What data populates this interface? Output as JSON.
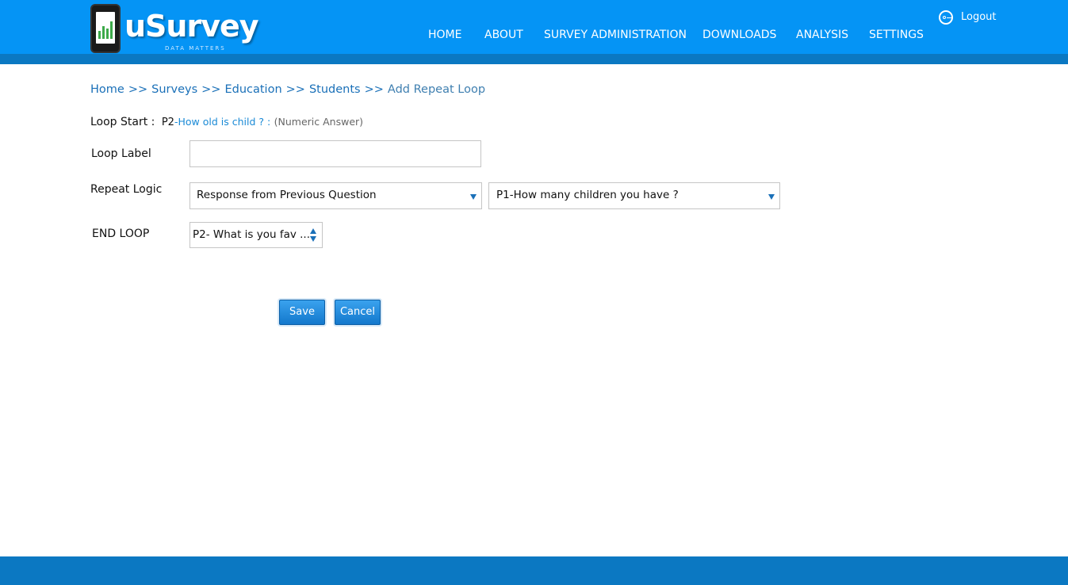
{
  "brand": {
    "name": "uSurvey",
    "tagline": "DATA MATTERS"
  },
  "nav": {
    "items": [
      {
        "label": "HOME"
      },
      {
        "label": "ABOUT"
      },
      {
        "label": "SURVEY ADMINISTRATION"
      },
      {
        "label": "DOWNLOADS"
      },
      {
        "label": "ANALYSIS"
      },
      {
        "label": "SETTINGS"
      }
    ],
    "logout_label": "Logout"
  },
  "breadcrumb": {
    "items": [
      "Home",
      "Surveys",
      "Education",
      "Students"
    ],
    "separator": ">>",
    "current": "Add Repeat Loop"
  },
  "loop_start": {
    "label": "Loop Start :",
    "question_code": "P2",
    "dash": "-",
    "question_text": "How old is child ? :",
    "question_type": "(Numeric Answer)"
  },
  "form": {
    "loop_label": {
      "label": "Loop Label",
      "value": ""
    },
    "repeat_logic": {
      "label": "Repeat Logic",
      "selected": "Response from Previous Question",
      "question_selected": "P1-How many children you have ?"
    },
    "end_loop": {
      "label": "END LOOP",
      "selected": "P2- What is you fav ..."
    },
    "save_label": "Save",
    "cancel_label": "Cancel"
  },
  "colors": {
    "header": "#0594f5",
    "header_stripe": "#0b78c2",
    "footer": "#0b78c2",
    "link": "#1a70b8",
    "button": "#1f86d8"
  }
}
